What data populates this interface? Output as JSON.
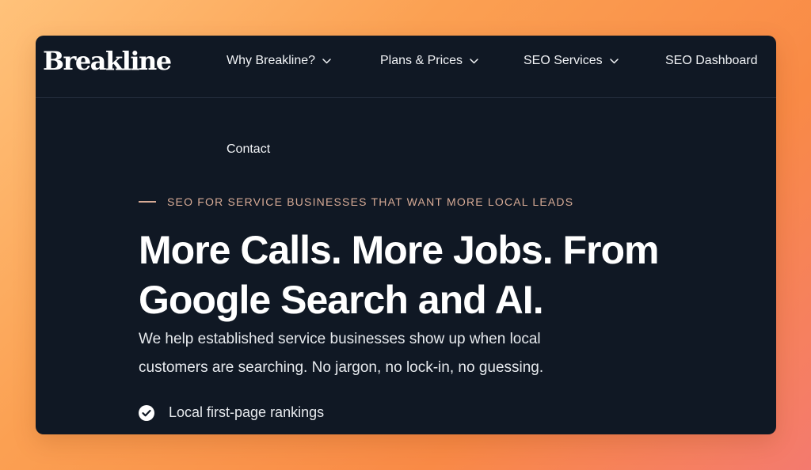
{
  "brand": {
    "logo_text": "Breakline"
  },
  "nav": {
    "items": [
      {
        "label": "Why Breakline?",
        "has_dropdown": true
      },
      {
        "label": "Plans & Prices",
        "has_dropdown": true
      },
      {
        "label": "SEO Services",
        "has_dropdown": true
      },
      {
        "label": "SEO Dashboard",
        "has_dropdown": false
      },
      {
        "label": "Contact",
        "has_dropdown": false
      }
    ]
  },
  "hero": {
    "eyebrow": "SEO FOR SERVICE BUSINESSES THAT WANT MORE LOCAL LEADS",
    "headline_line1": "More Calls. More Jobs. From",
    "headline_line2": "Google Search and AI.",
    "subtitle_line1": "We help established service businesses show up when local",
    "subtitle_line2": "customers are searching. No jargon, no lock-in, no guessing.",
    "features": [
      {
        "label": "Local first-page rankings",
        "icon": "check-circle-icon"
      }
    ]
  },
  "colors": {
    "panel_bg": "#101824",
    "eyebrow": "#d7ab96",
    "text": "#ffffff",
    "gradient_start": "#ffc27a",
    "gradient_end": "#f47a6e"
  }
}
